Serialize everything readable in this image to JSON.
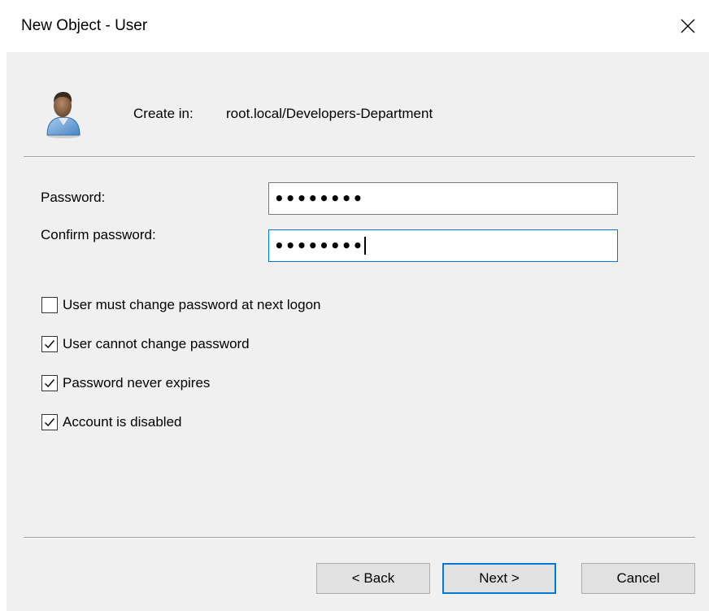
{
  "window": {
    "title": "New Object - User",
    "close_icon": "close-icon"
  },
  "header": {
    "icon": "user-icon",
    "create_in_label": "Create in:",
    "create_in_path": "root.local/Developers-Department"
  },
  "form": {
    "password_label": "Password:",
    "password_value": "••••••••",
    "confirm_label": "Confirm password:",
    "confirm_value": "••••••••"
  },
  "options": [
    {
      "label": "User must change password at next logon",
      "checked": false
    },
    {
      "label": "User cannot change password",
      "checked": true
    },
    {
      "label": "Password never expires",
      "checked": true
    },
    {
      "label": "Account is disabled",
      "checked": true
    }
  ],
  "buttons": {
    "back": "< Back",
    "next": "Next >",
    "cancel": "Cancel"
  },
  "colors": {
    "dialog_bg": "#f0f0f0",
    "focus_accent": "#0078d7",
    "button_bg": "#e1e1e1"
  }
}
